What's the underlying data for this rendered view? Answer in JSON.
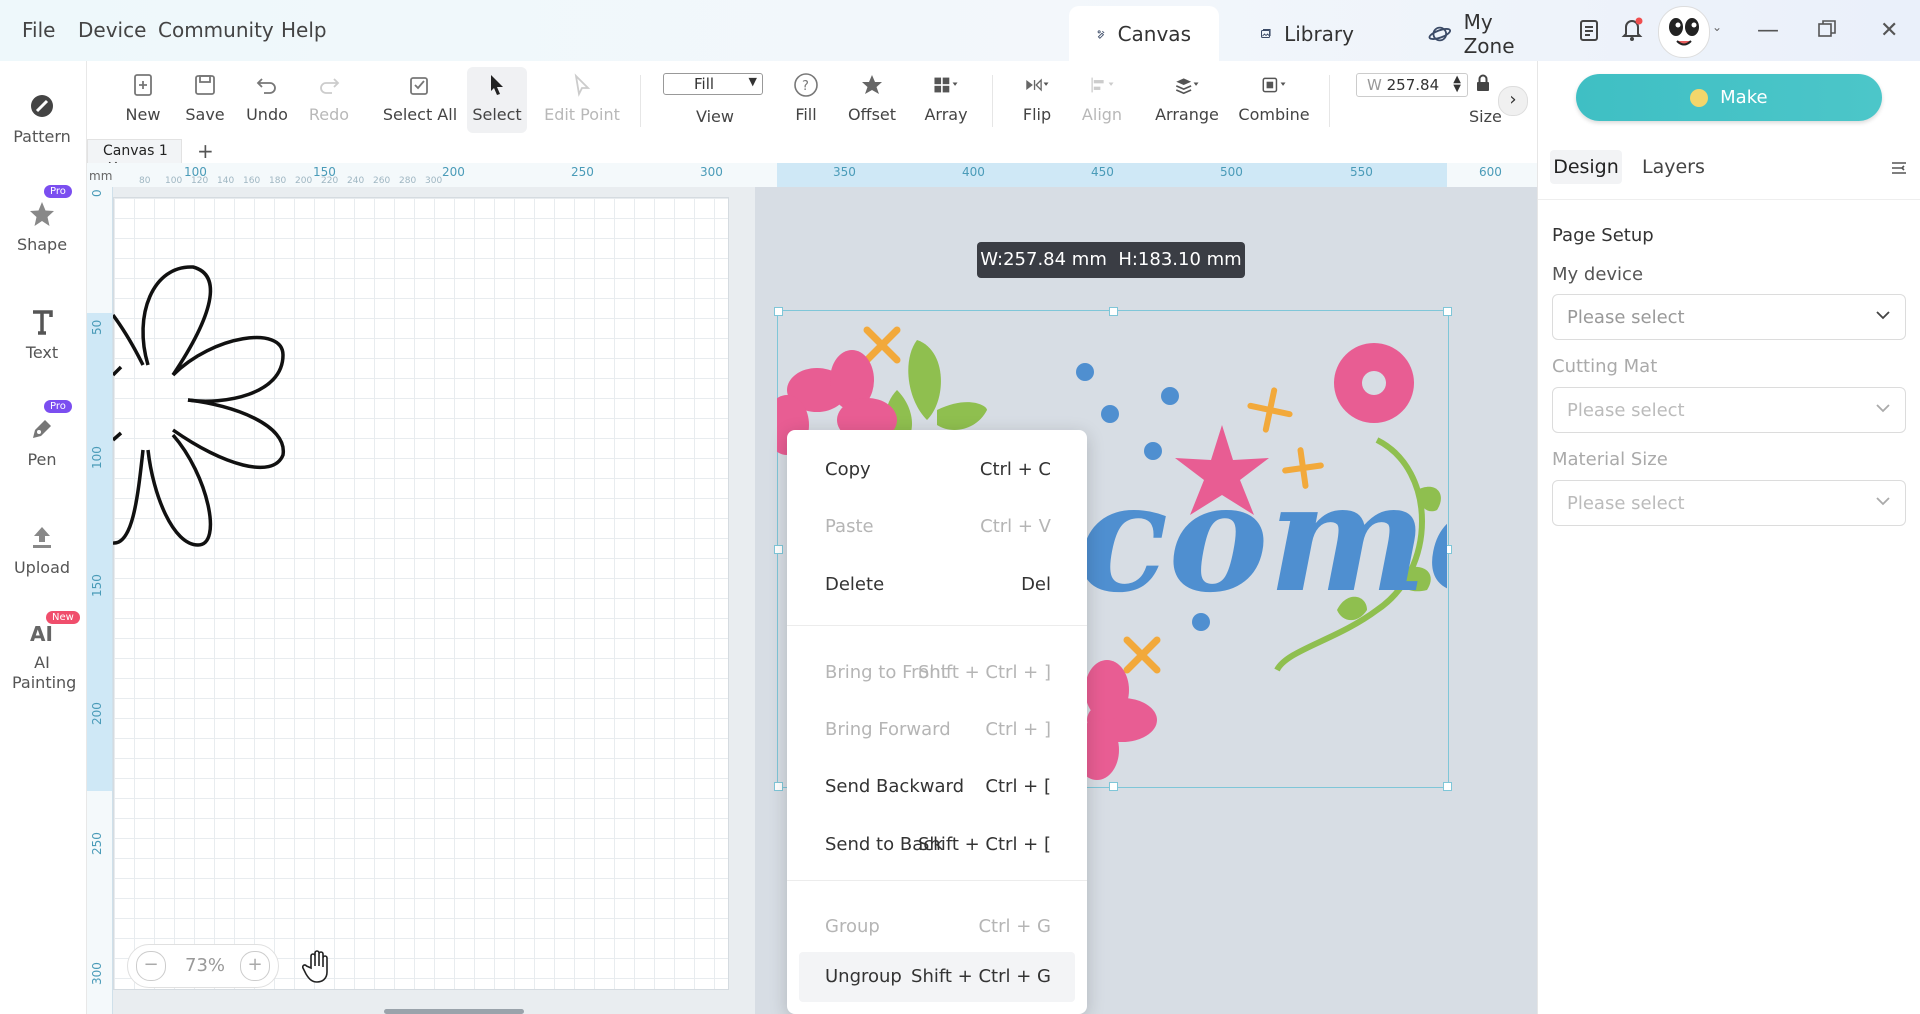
{
  "menu": {
    "file": "File",
    "device": "Device",
    "community": "Community",
    "help": "Help"
  },
  "top_tabs": [
    {
      "label": "Canvas",
      "active": true
    },
    {
      "label": "Library",
      "active": false
    },
    {
      "label": "My Zone",
      "active": false
    }
  ],
  "left_rail": [
    {
      "label": "Pattern",
      "badge": ""
    },
    {
      "label": "Shape",
      "badge": "Pro"
    },
    {
      "label": "Text",
      "badge": ""
    },
    {
      "label": "Pen",
      "badge": "Pro"
    },
    {
      "label": "Upload",
      "badge": ""
    },
    {
      "label": "AI Painting",
      "badge": "New"
    }
  ],
  "toolbar": {
    "new": "New",
    "save": "Save",
    "undo": "Undo",
    "redo": "Redo",
    "select_all": "Select All",
    "select": "Select",
    "edit_point": "Edit Point",
    "view_value": "Fill",
    "view_label": "View",
    "fill": "Fill",
    "offset": "Offset",
    "array": "Array",
    "flip": "Flip",
    "align": "Align",
    "arrange": "Arrange",
    "combine": "Combine",
    "width_prefix": "W",
    "width_value": "257.84",
    "size_label": "Size"
  },
  "canvas_tab": {
    "label": "Canvas 1",
    "close": "✕",
    "add": "+"
  },
  "ruler": {
    "unit": "mm",
    "top_major": [
      "100",
      "150",
      "200",
      "250",
      "300",
      "350",
      "400",
      "450",
      "500",
      "550",
      "600"
    ],
    "top_minor": [
      "80",
      "100",
      "120",
      "140",
      "160",
      "180",
      "200",
      "220",
      "240",
      "260",
      "280",
      "300"
    ],
    "left_major": [
      "0",
      "50",
      "100",
      "150",
      "200",
      "250",
      "300"
    ]
  },
  "size_tooltip": "W:257.84 mm  H:183.10 mm",
  "design_text": "come",
  "context_menu": [
    {
      "label": "Copy",
      "shortcut": "Ctrl + C",
      "enabled": true
    },
    {
      "label": "Paste",
      "shortcut": "Ctrl + V",
      "enabled": false
    },
    {
      "label": "Delete",
      "shortcut": "Del",
      "enabled": true
    },
    {
      "label": "Bring to Front",
      "shortcut": "Shift + Ctrl + ]",
      "enabled": false
    },
    {
      "label": "Bring Forward",
      "shortcut": "Ctrl + ]",
      "enabled": false
    },
    {
      "label": "Send Backward",
      "shortcut": "Ctrl + [",
      "enabled": true
    },
    {
      "label": "Send to Back",
      "shortcut": "Shift + Ctrl + [",
      "enabled": true
    },
    {
      "label": "Group",
      "shortcut": "Ctrl + G",
      "enabled": false
    },
    {
      "label": "Ungroup",
      "shortcut": "Shift + Ctrl + G",
      "enabled": true
    }
  ],
  "zoom": {
    "minus": "−",
    "value": "73%",
    "plus": "+"
  },
  "right_panel": {
    "make_button": "Make",
    "tabs": [
      "Design",
      "Layers"
    ],
    "page_setup": "Page Setup",
    "my_device": "My device",
    "cutting_mat": "Cutting Mat",
    "material_size": "Material Size",
    "placeholder": "Please select"
  },
  "colors": {
    "accent": "#3fbfc4",
    "pink": "#e85d93",
    "blue": "#4f8fd0",
    "green": "#8fbf4f",
    "orange": "#f2a93b"
  },
  "icons": [
    "canvas-icon",
    "library-icon",
    "my-zone-icon",
    "clipboard-icon",
    "bell-icon",
    "avatar",
    "minimize-icon",
    "restore-icon",
    "close-icon"
  ]
}
